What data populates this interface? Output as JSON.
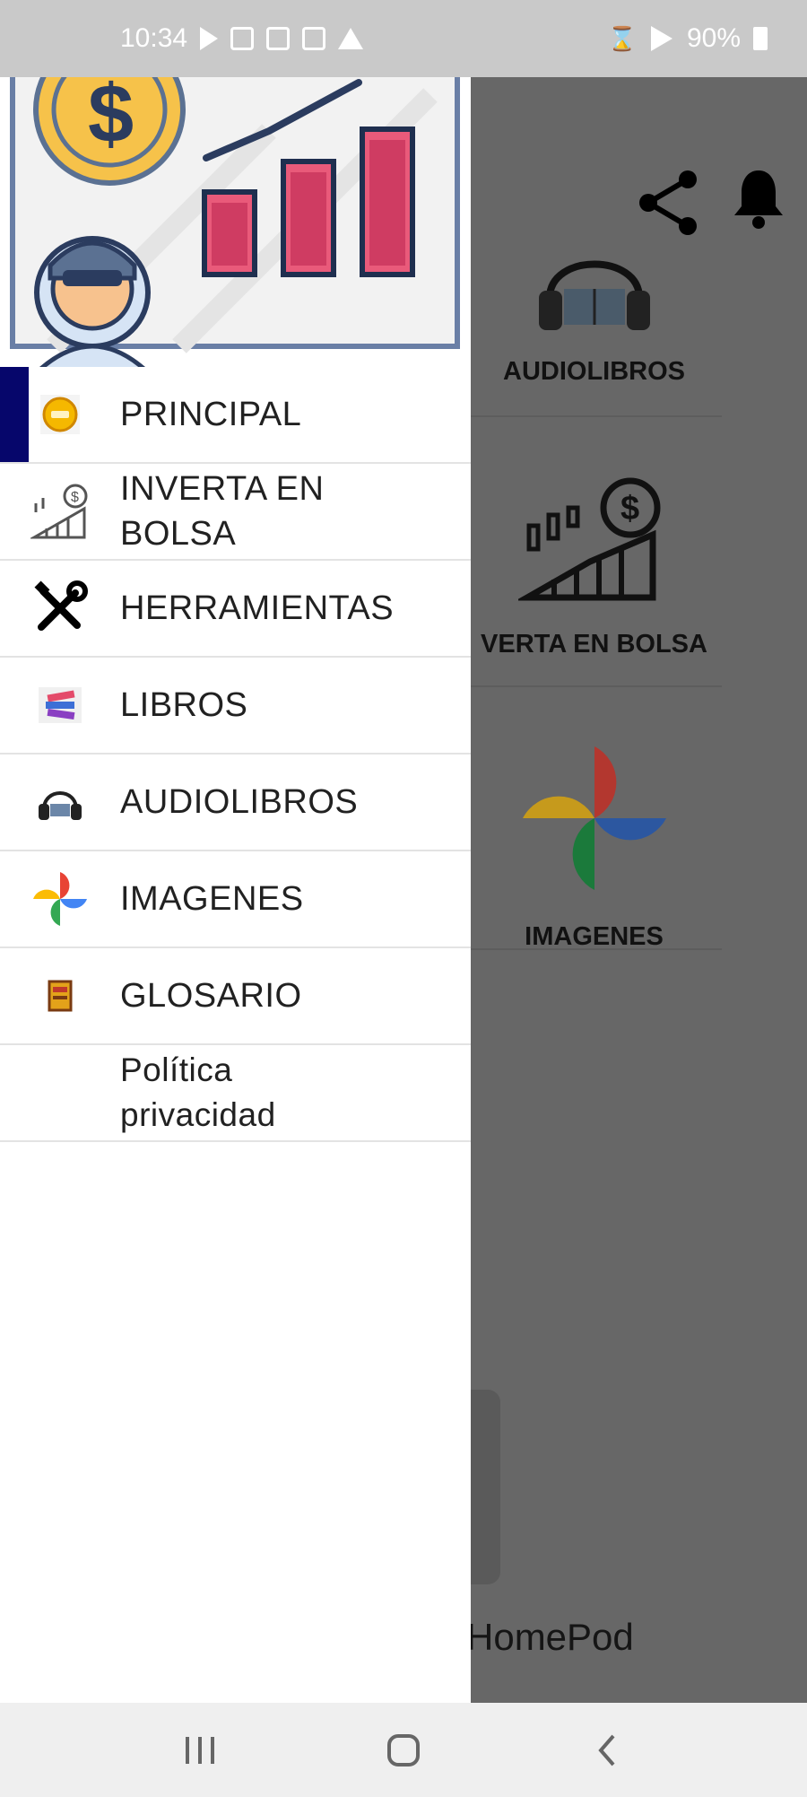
{
  "status_bar": {
    "time": "10:34",
    "battery": "90%"
  },
  "background_app": {
    "tiles": [
      {
        "label": "AUDIOLIBROS",
        "icon": "headphones-book-icon"
      },
      {
        "label": "VERTA EN BOLSA",
        "icon": "stock-growth-icon"
      },
      {
        "label": "IMAGENES",
        "icon": "pinwheel-icon"
      }
    ],
    "card_title": "HomePod"
  },
  "drawer": {
    "header_image": "investor-chart-illustration",
    "items": [
      {
        "label": "PRINCIPAL",
        "icon": "coin-icon",
        "active": true
      },
      {
        "label": "INVERTA EN BOLSA",
        "icon": "stock-chart-icon",
        "active": false
      },
      {
        "label": "HERRAMIENTAS",
        "icon": "tools-icon",
        "active": false
      },
      {
        "label": "LIBROS",
        "icon": "books-icon",
        "active": false
      },
      {
        "label": "AUDIOLIBROS",
        "icon": "headphones-icon",
        "active": false
      },
      {
        "label": "IMAGENES",
        "icon": "pinwheel-icon",
        "active": false
      },
      {
        "label": "GLOSARIO",
        "icon": "glossary-icon",
        "active": false
      },
      {
        "label": "Política privacidad",
        "icon": "",
        "active": false
      }
    ],
    "accent_color": "#06066b"
  },
  "nav_bar": {
    "buttons": [
      "recents",
      "home",
      "back"
    ]
  }
}
